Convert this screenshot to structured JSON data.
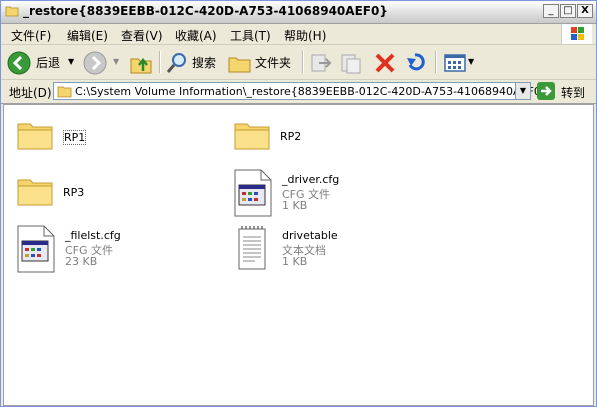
{
  "window": {
    "title": "_restore{8839EEBB-012C-420D-A753-41068940AEF0}",
    "controls": {
      "minimize": "_",
      "maximize": "□",
      "close": "X"
    }
  },
  "menu": {
    "items": [
      "文件(F)",
      "编辑(E)",
      "查看(V)",
      "收藏(A)",
      "工具(T)",
      "帮助(H)"
    ]
  },
  "toolbar": {
    "back_label": "后退",
    "search_label": "搜索",
    "folders_label": "文件夹"
  },
  "address": {
    "label": "地址(D)",
    "path": "C:\\System Volume Information\\_restore{8839EEBB-012C-420D-A753-41068940AEF0}",
    "go_label": "转到"
  },
  "items": [
    {
      "name": "RP1",
      "type": "folder"
    },
    {
      "name": "RP2",
      "type": "folder"
    },
    {
      "name": "RP3",
      "type": "folder"
    },
    {
      "name": "_driver.cfg",
      "type": "cfg",
      "kind": "CFG 文件",
      "size": "1 KB"
    },
    {
      "name": "_filelst.cfg",
      "type": "cfg",
      "kind": "CFG 文件",
      "size": "23 KB"
    },
    {
      "name": "drivetable",
      "type": "txt",
      "kind": "文本文档",
      "size": "1 KB"
    }
  ],
  "colors": {
    "folder": "#f5d66e",
    "back_green": "#3a9a3a",
    "delete_red": "#e03020",
    "undo_blue": "#2060d0"
  }
}
